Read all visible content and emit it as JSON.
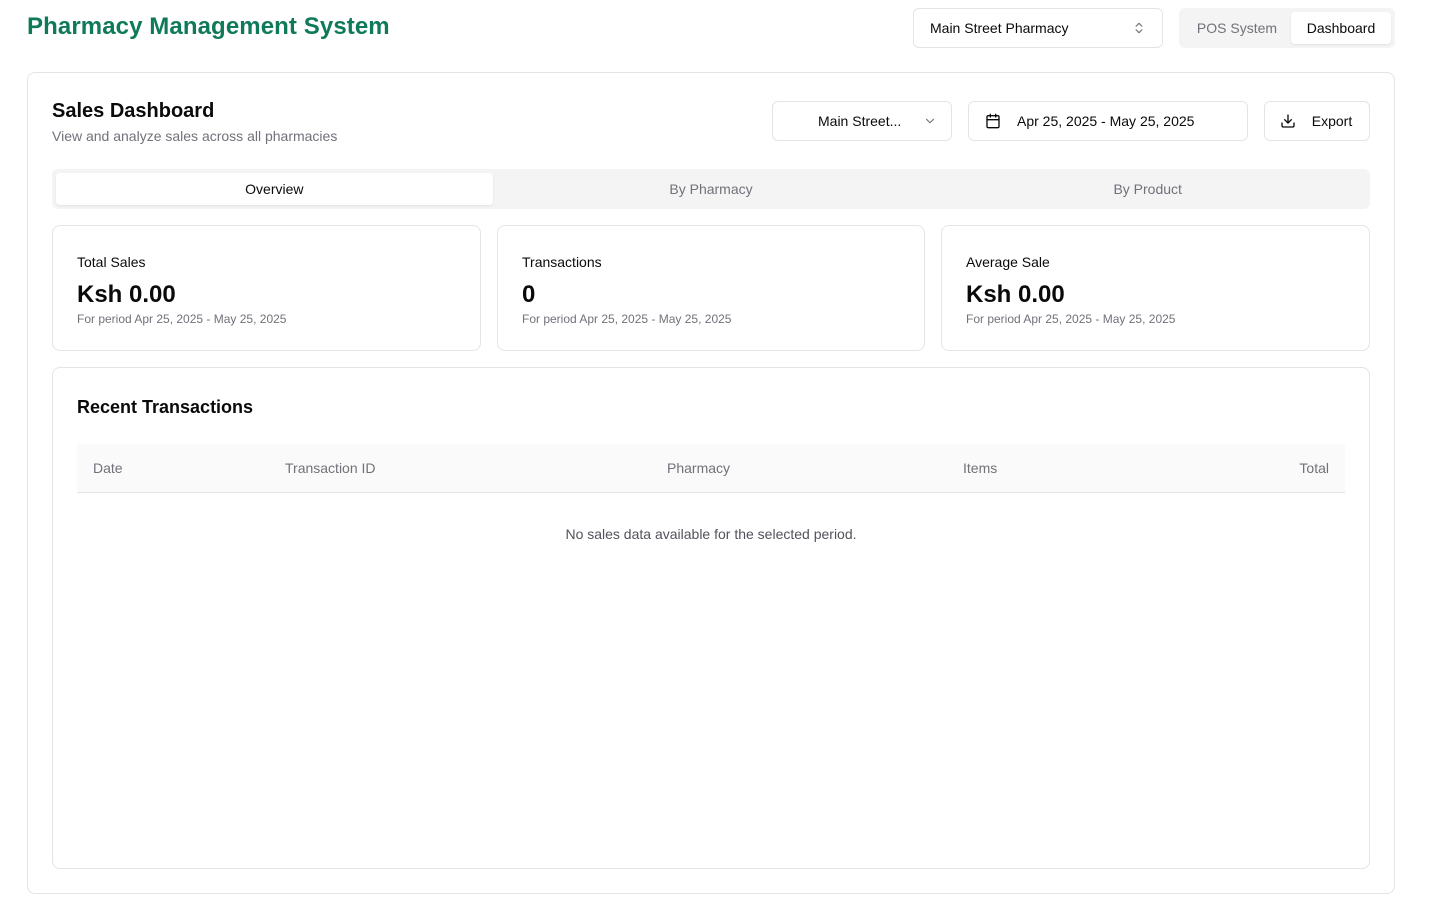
{
  "header": {
    "app_title": "Pharmacy Management System",
    "pharmacy_select": "Main Street Pharmacy",
    "modes": [
      "POS System",
      "Dashboard"
    ],
    "active_mode": "Dashboard"
  },
  "dashboard": {
    "title": "Sales Dashboard",
    "subtitle": "View and analyze sales across all pharmacies",
    "pharmacy_filter": "Main Street...",
    "date_range": "Apr 25, 2025 - May 25, 2025",
    "export_label": "Export",
    "tabs": [
      "Overview",
      "By Pharmacy",
      "By Product"
    ],
    "active_tab": "Overview"
  },
  "stats": [
    {
      "label": "Total Sales",
      "value": "Ksh 0.00",
      "note": "For period Apr 25, 2025 - May 25, 2025"
    },
    {
      "label": "Transactions",
      "value": "0",
      "note": "For period Apr 25, 2025 - May 25, 2025"
    },
    {
      "label": "Average Sale",
      "value": "Ksh 0.00",
      "note": "For period Apr 25, 2025 - May 25, 2025"
    }
  ],
  "transactions": {
    "title": "Recent Transactions",
    "columns": [
      "Date",
      "Transaction ID",
      "Pharmacy",
      "Items",
      "Total"
    ],
    "empty_message": "No sales data available for the selected period."
  },
  "colors": {
    "brand": "#0f7a5a",
    "muted_text": "#71717a",
    "border": "#e4e4e7"
  },
  "icons": {
    "pharmacy_select": "chevrons-up-down-icon",
    "pharmacy_filter": "chevron-down-icon",
    "date_range": "calendar-icon",
    "export": "download-icon"
  }
}
